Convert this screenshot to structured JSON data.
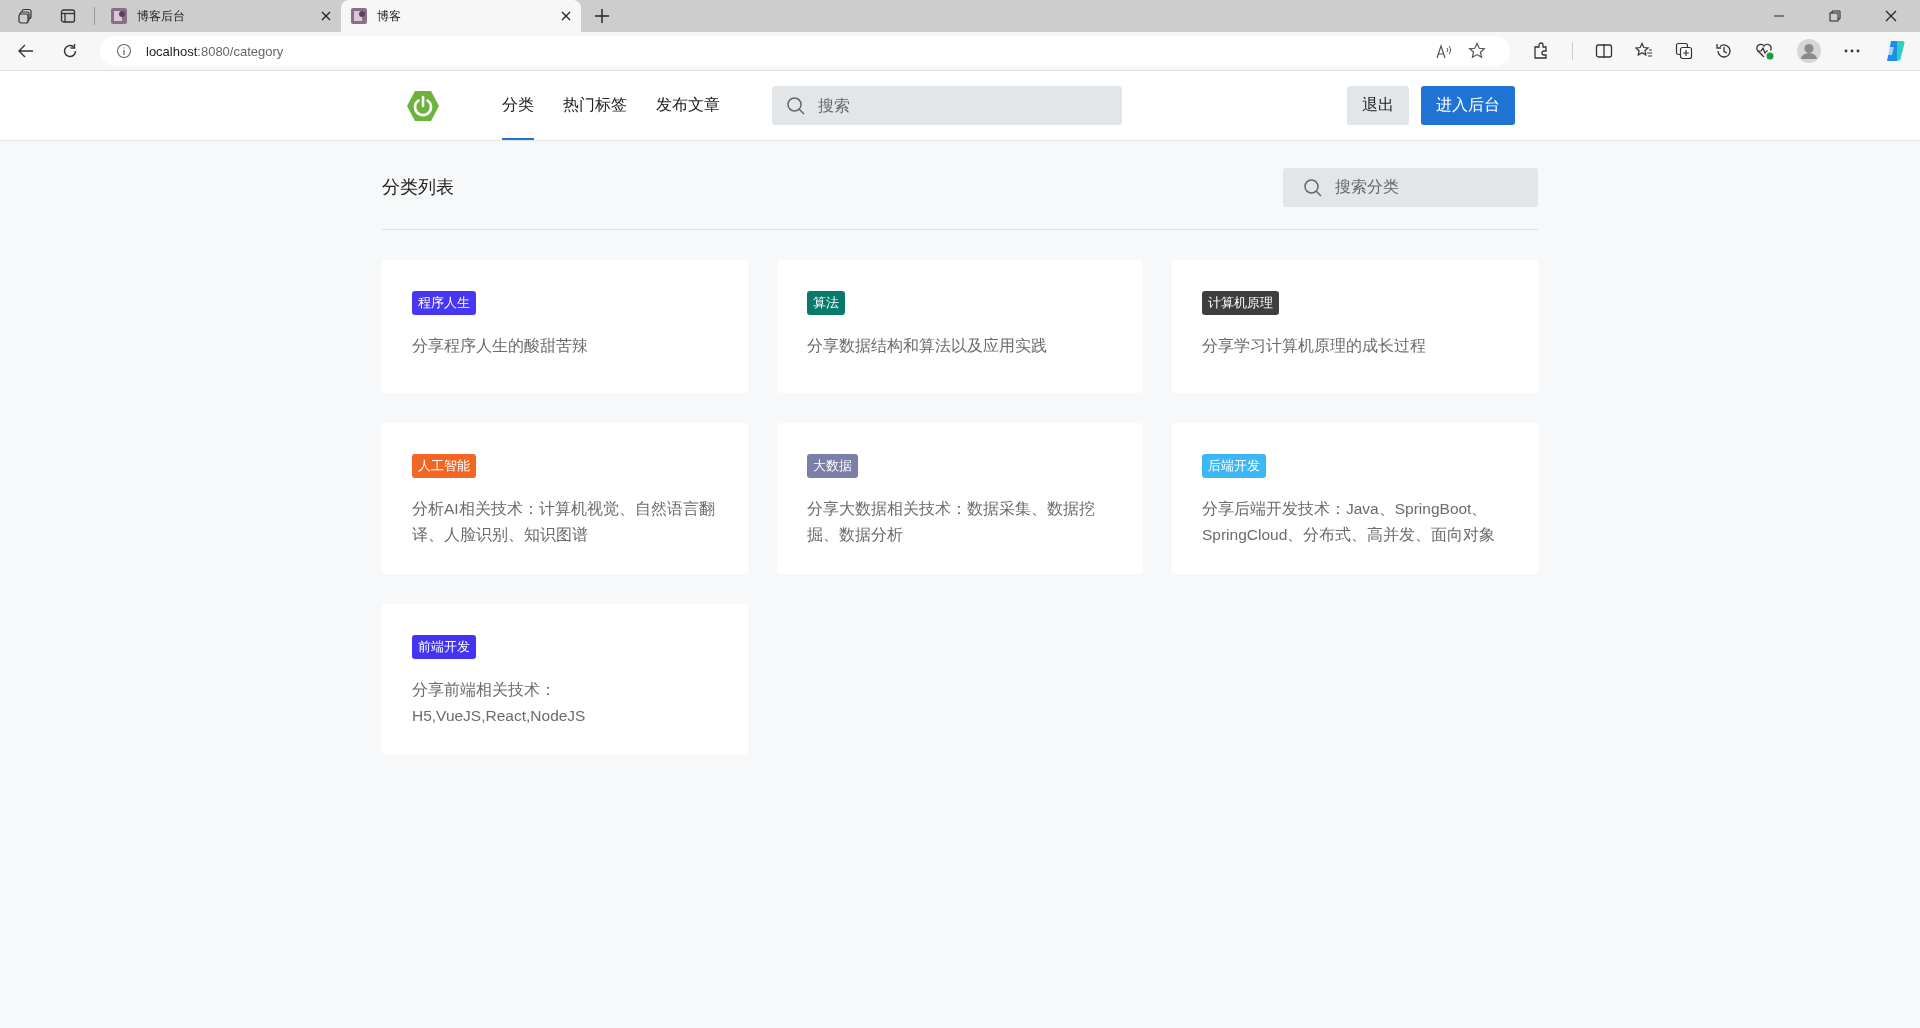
{
  "browser": {
    "tabs": [
      {
        "title": "博客后台",
        "selected": false
      },
      {
        "title": "博客",
        "selected": true
      }
    ],
    "host": "localhost",
    "path": ":8080/category"
  },
  "header": {
    "nav": [
      {
        "label": "分类",
        "selected": true
      },
      {
        "label": "热门标签",
        "selected": false
      },
      {
        "label": "发布文章",
        "selected": false
      }
    ],
    "search": {
      "placeholder": "搜索"
    },
    "buttons": [
      {
        "label": "退出",
        "kind": "secondary"
      },
      {
        "label": "进入后台",
        "kind": "primary"
      }
    ]
  },
  "page": {
    "title": "分类列表",
    "search": {
      "placeholder": "搜索分类"
    }
  },
  "categories": [
    {
      "name": "程序人生",
      "color": "#4836f5",
      "description": "分享程序人生的酸甜苦辣"
    },
    {
      "name": "算法",
      "color": "#08796b",
      "description": "分享数据结构和算法以及应用实践"
    },
    {
      "name": "计算机原理",
      "color": "#3e3e3e",
      "description": "分享学习计算机原理的成长过程"
    },
    {
      "name": "人工智能",
      "color": "#f26522",
      "description": "分析AI相关技术：计算机视觉、自然语言翻译、人脸识别、知识图谱"
    },
    {
      "name": "大数据",
      "color": "#7b7ea6",
      "description": "分享大数据相关技术：数据采集、数据挖掘、数据分析"
    },
    {
      "name": "后端开发",
      "color": "#3db8f5",
      "description": "分享后端开发技术：Java、SpringBoot、SpringCloud、分布式、高并发、面向对象"
    },
    {
      "name": "前端开发",
      "color": "#4433f0",
      "description": "分享前端相关技术：H5,VueJS,React,NodeJS"
    }
  ]
}
